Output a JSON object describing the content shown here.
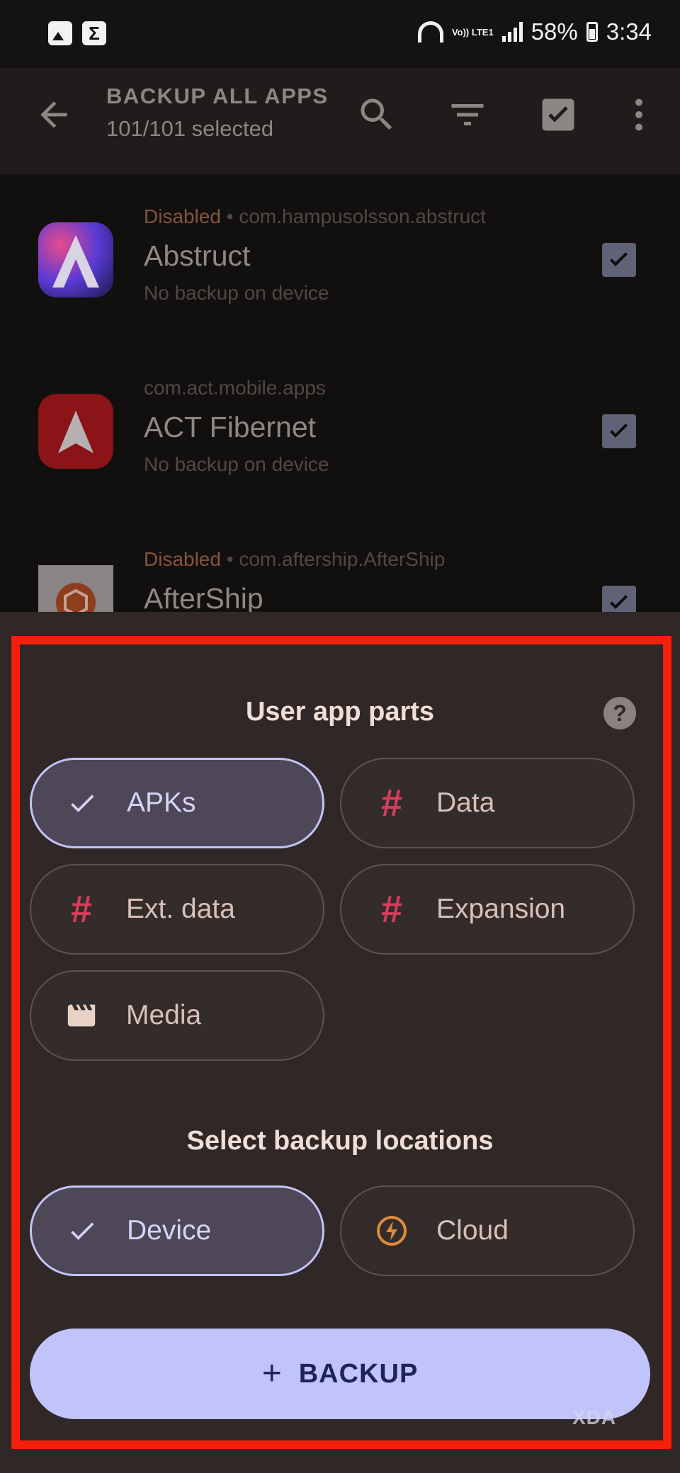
{
  "status_bar": {
    "volte": "Vo)) LTE1",
    "battery": "58%",
    "time": "3:34"
  },
  "appbar": {
    "title": "BACKUP ALL APPS",
    "subtitle": "101/101 selected"
  },
  "apps": [
    {
      "state": "Disabled",
      "package": "com.hampusolsson.abstruct",
      "name": "Abstruct",
      "backup_status": "No backup on device",
      "checked": true
    },
    {
      "state": "",
      "package": "com.act.mobile.apps",
      "name": "ACT Fibernet",
      "backup_status": "No backup on device",
      "checked": true
    },
    {
      "state": "Disabled",
      "package": "com.aftership.AfterShip",
      "name": "AfterShip",
      "backup_status": "",
      "checked": true
    }
  ],
  "sheet": {
    "parts_title": "User app parts",
    "help": "?",
    "parts": [
      {
        "label": "APKs",
        "selected": true,
        "icon": "check-icon"
      },
      {
        "label": "Data",
        "selected": false,
        "icon": "hash-icon"
      },
      {
        "label": "Ext. data",
        "selected": false,
        "icon": "hash-icon"
      },
      {
        "label": "Expansion",
        "selected": false,
        "icon": "hash-icon"
      },
      {
        "label": "Media",
        "selected": false,
        "icon": "clapperboard-icon"
      }
    ],
    "locations_title": "Select backup locations",
    "locations": [
      {
        "label": "Device",
        "selected": true,
        "icon": "check-icon"
      },
      {
        "label": "Cloud",
        "selected": false,
        "icon": "bolt-icon"
      }
    ],
    "action": {
      "icon": "+",
      "label": "BACKUP"
    }
  },
  "watermark": "XDA",
  "colors": {
    "highlight_frame": "#f4200b",
    "accent": "#c1c3fb",
    "hash": "#d43d5c",
    "cloud": "#e08a3c"
  }
}
